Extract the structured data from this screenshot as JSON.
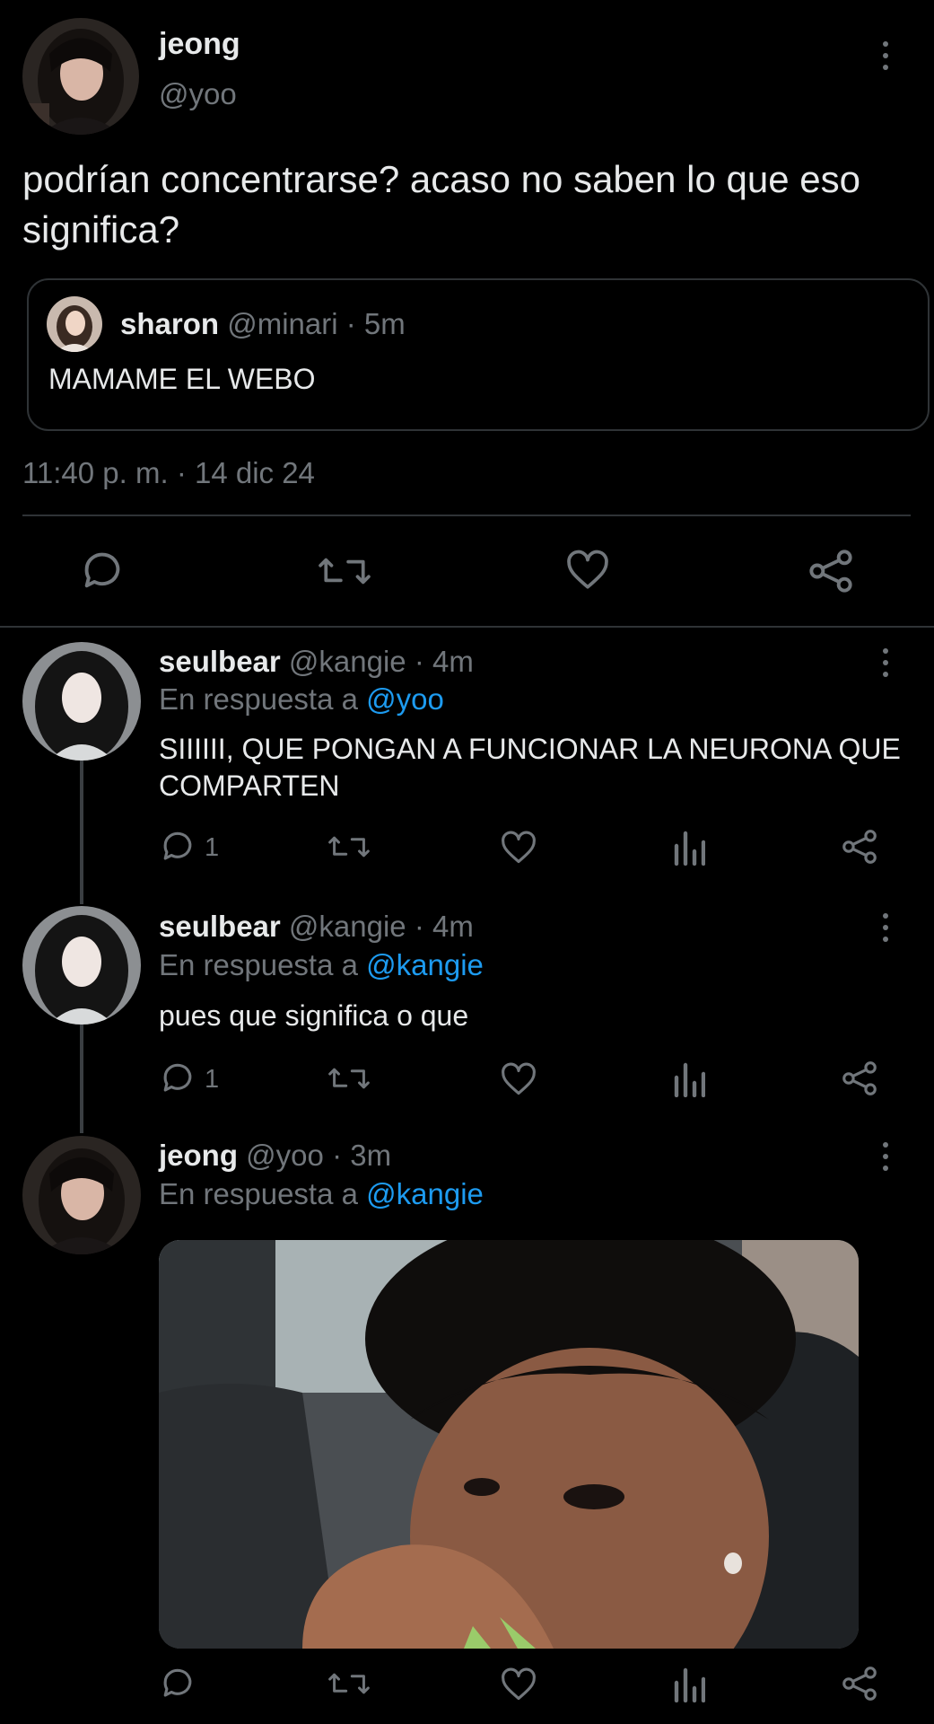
{
  "main_tweet": {
    "author_name": "jeong",
    "author_handle": "@yoo",
    "text": "podrían concentrarse? acaso no saben lo que eso significa?",
    "quote": {
      "author_name": "sharon",
      "author_handle": "@minari",
      "time": "· 5m",
      "text": "MAMAME EL WEBO"
    },
    "timestamp": "11:40 p. m. · 14 dic 24"
  },
  "replies": [
    {
      "author_name": "seulbear",
      "author_handle": "@kangie",
      "time": "· 4m",
      "reply_prefix": "En respuesta a",
      "reply_to": "@yoo",
      "text": "SIIIIII, QUE PONGAN A FUNCIONAR LA NEURONA QUE COMPARTEN",
      "reply_count": "1"
    },
    {
      "author_name": "seulbear",
      "author_handle": "@kangie",
      "time": "· 4m",
      "reply_prefix": "En respuesta a",
      "reply_to": "@kangie",
      "text": "pues que significa o que",
      "reply_count": "1"
    },
    {
      "author_name": "jeong",
      "author_handle": "@yoo",
      "time": "· 3m",
      "reply_prefix": "En respuesta a",
      "reply_to": "@kangie",
      "text": "",
      "reply_count": ""
    }
  ],
  "icons": {
    "reply": "reply-icon",
    "retweet": "retweet-icon",
    "like": "heart-icon",
    "views": "views-icon",
    "share": "share-icon",
    "more": "more-icon"
  },
  "colors": {
    "background": "#000000",
    "text": "#e7e9ea",
    "muted": "#71767b",
    "link": "#1d9bf0",
    "border": "#2f3336"
  }
}
